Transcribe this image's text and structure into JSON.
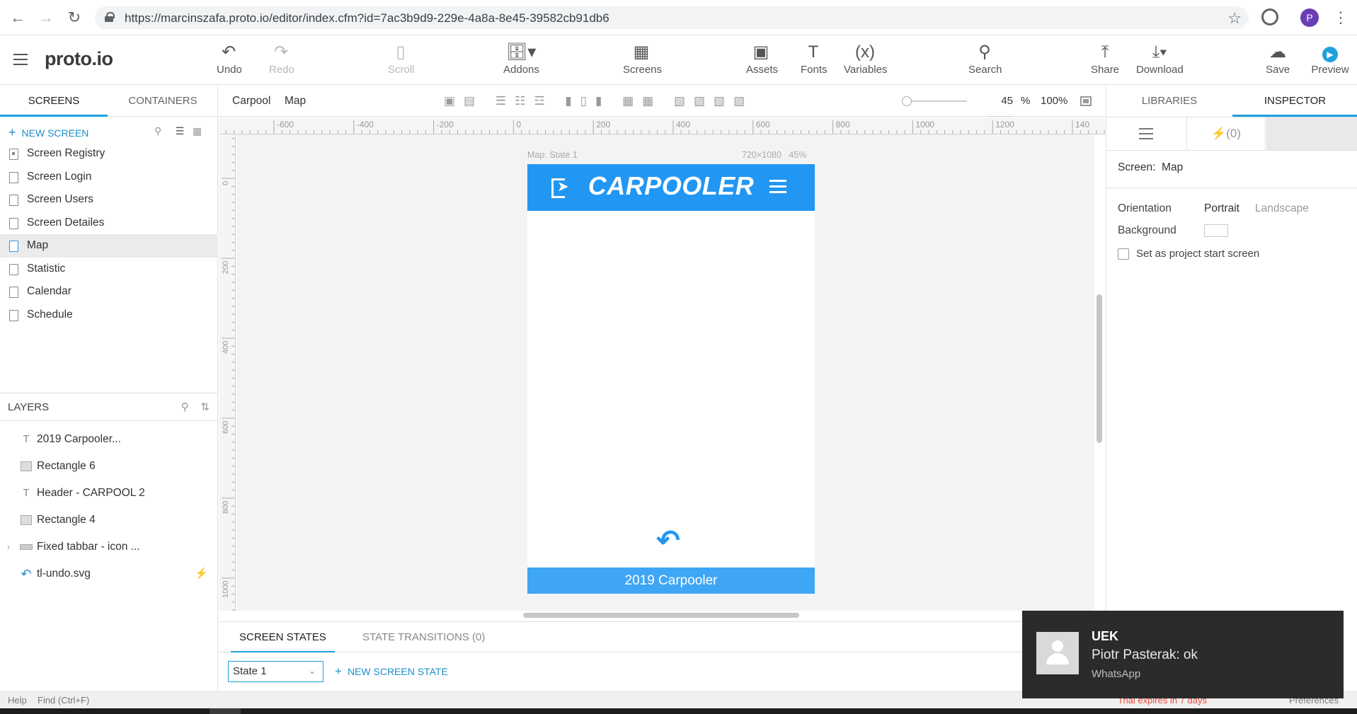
{
  "browser": {
    "url": "https://marcinszafa.proto.io/editor/index.cfm?id=7ac3b9d9-229e-4a8a-8e45-39582cb91db6",
    "profile_initial": "P"
  },
  "app": {
    "logo": "proto.io",
    "toolbar": {
      "undo": "Undo",
      "redo": "Redo",
      "scroll": "Scroll",
      "addons": "Addons",
      "screens": "Screens",
      "assets": "Assets",
      "fonts": "Fonts",
      "variables": "Variables",
      "search": "Search",
      "share": "Share",
      "download": "Download",
      "save": "Save",
      "preview": "Preview"
    }
  },
  "left_panel": {
    "tabs": [
      "SCREENS",
      "CONTAINERS"
    ],
    "new_screen": "NEW SCREEN",
    "screens": [
      "Screen Registry",
      "Screen Login",
      "Screen Users",
      "Screen Detailes",
      "Map",
      "Statistic",
      "Calendar",
      "Schedule"
    ],
    "active_screen": "Map",
    "layers_title": "LAYERS",
    "layers": [
      "2019 Carpooler...",
      "Rectangle 6",
      "Header - CARPOOL 2",
      "Rectangle 4",
      "Fixed tabbar - icon ...",
      "tl-undo.svg"
    ]
  },
  "center": {
    "breadcrumb": [
      "Carpool",
      "Map"
    ],
    "zoom_value": "45",
    "zoom_unit": "%",
    "zoom_reset": "100%",
    "ruler_h": [
      "-600",
      "-400",
      "-200",
      "0",
      "200",
      "400",
      "600",
      "800",
      "1000",
      "1200",
      "140"
    ],
    "ruler_v": [
      "0",
      "200",
      "400",
      "600",
      "800",
      "1000"
    ],
    "frame_caption_left": "Map: State 1",
    "frame_caption_right": "720×1080   45%",
    "device": {
      "brand": "CARPOOLER",
      "footer": "2019 Carpooler",
      "header_color": "#2196f3",
      "footer_color": "#3ea6f5"
    },
    "states_tabs": [
      "SCREEN STATES",
      "STATE TRANSITIONS (0)"
    ],
    "state_select": "State 1",
    "new_state": "NEW SCREEN STATE"
  },
  "right_panel": {
    "tabs": [
      "LIBRARIES",
      "INSPECTOR"
    ],
    "interactions": "(0)",
    "screen_label": "Screen:",
    "screen_value": "Map",
    "orientation_label": "Orientation",
    "orientation_options": [
      "Portrait",
      "Landscape"
    ],
    "background_label": "Background",
    "start_screen_label": "Set as project start screen"
  },
  "status": {
    "help": "Help",
    "find": "Find (Ctrl+F)",
    "trial": "Trial expires in 7 days",
    "preferences": "Preferences"
  },
  "toast": {
    "title": "UEK",
    "message": "Piotr Pasterak: ok",
    "app": "WhatsApp"
  },
  "colors": {
    "accent": "#1ea1de",
    "brand_blue": "#2196f3"
  }
}
